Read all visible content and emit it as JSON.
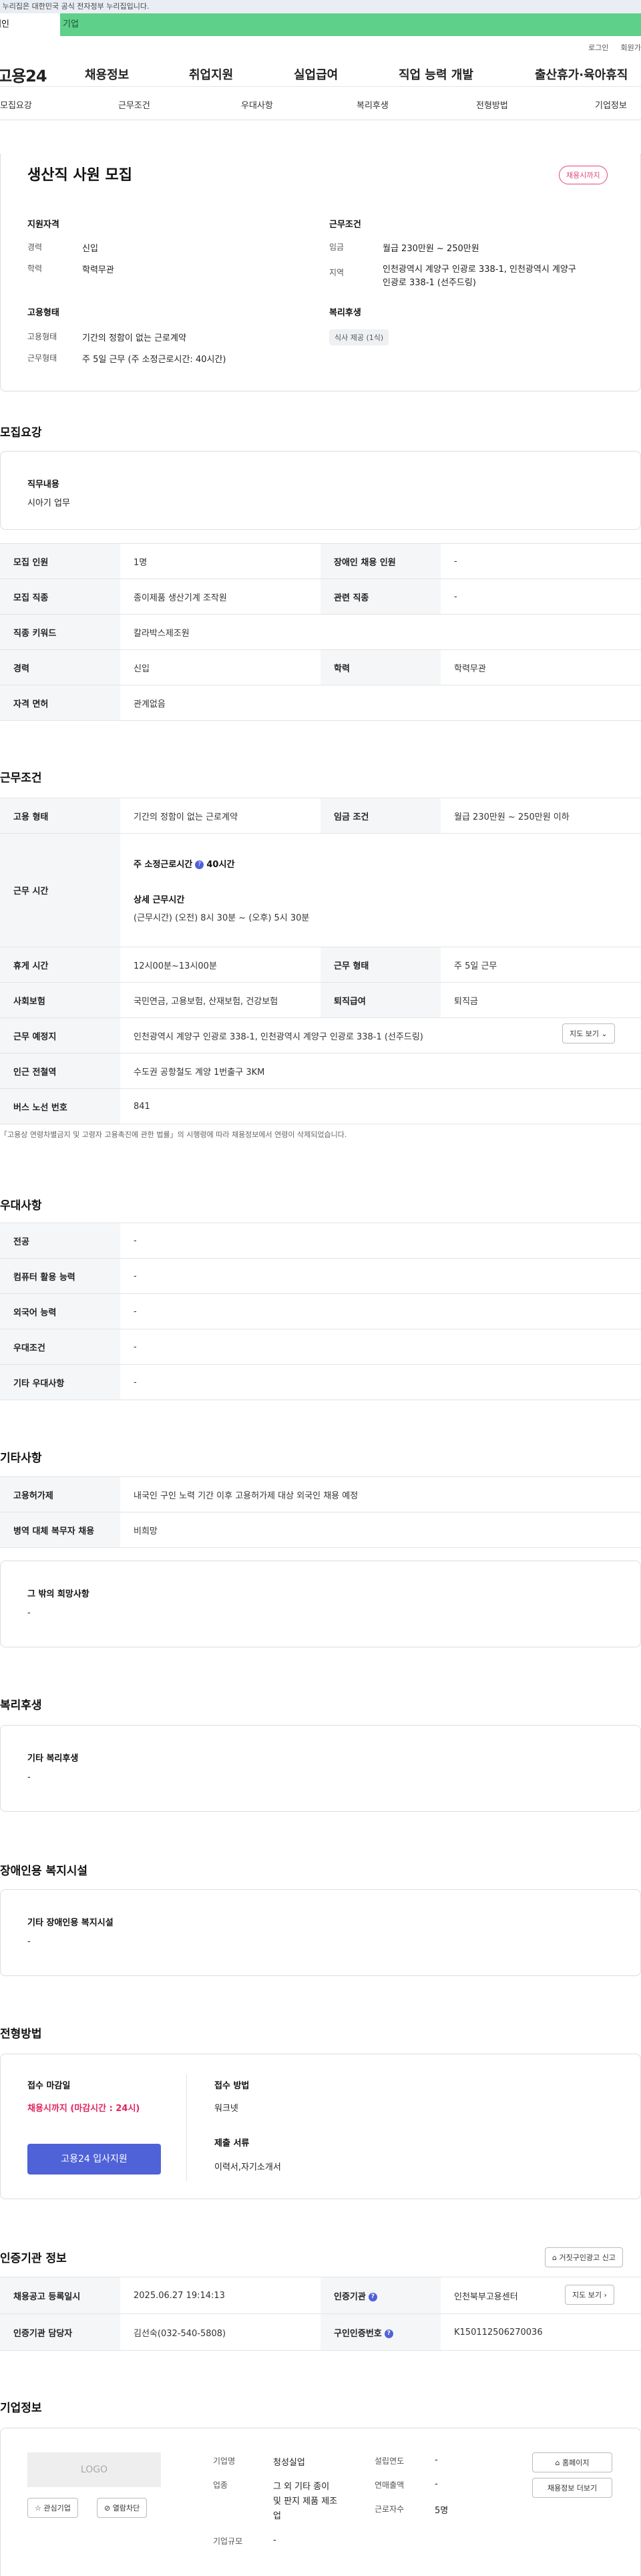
{
  "gov_banner": "이 누리집은 대한민국 공식 전자정부 누리집입니다.",
  "user_tabs": {
    "person": "개인",
    "company": "기업"
  },
  "util": {
    "login": "로그인",
    "join": "회원가입"
  },
  "logo": "고용24",
  "gnb": [
    "채용정보",
    "취업지원",
    "실업급여",
    "직업 능력 개발",
    "출산휴가·육아휴직"
  ],
  "subnav": [
    "모집요강",
    "근무조건",
    "우대사항",
    "복리후생",
    "전형방법",
    "기업정보"
  ],
  "job": {
    "title": "생산직 사원 모집",
    "status_badge": "채용시까지",
    "qualification_title": "지원자격",
    "career_label": "경력",
    "career_value": "신입",
    "education_label": "학력",
    "education_value": "학력무관",
    "employment_title": "고용형태",
    "employment_type_label": "고용형태",
    "employment_type_value": "기간의 정함이 없는 근로계약",
    "work_type_label": "근무형태",
    "work_type_value": "주 5일 근무 (주 소정근로시간: 40시간)",
    "conditions_title": "근무조건",
    "wage_label": "임금",
    "wage_value": "월급 230만원 ~ 250만원",
    "region_label": "지역",
    "region_value_1": "인천광역시 계양구 인광로 338-1, 인천광역시 계양구",
    "region_value_2": "인광로 338-1 (선주드링)",
    "welfare_title": "복리후생",
    "welfare_chip": "식사 제공 (1식)"
  },
  "recruit": {
    "title": "모집요강",
    "duty_label": "직무내용",
    "duty_value": "시아기 업무",
    "rows": [
      [
        "모집 인원",
        "1명",
        "장애인 채용 인원",
        "-"
      ],
      [
        "모집 직종",
        "종이제품 생산기계 조작원",
        "관련 직종",
        "-"
      ],
      [
        "직종 키워드",
        "칼라박스제조원"
      ],
      [
        "경력",
        "신입",
        "학력",
        "학력무관"
      ],
      [
        "자격 면허",
        "관계없음"
      ]
    ]
  },
  "work": {
    "title": "근무조건",
    "employment_label": "고용 형태",
    "employment_value": "기간의 정함이 없는 근로계약",
    "wage_label": "임금 조건",
    "wage_value": "월급 230만원 ~ 250만원 이하",
    "hours_label": "근무 시간",
    "weekly_hours_label": "주 소정근로시간",
    "weekly_hours_value": "40시간",
    "detail_hours_label": "상세 근무시간",
    "detail_hours_value": "(근무시간) (오전) 8시 30분 ~ (오후) 5시 30분",
    "rows": [
      [
        "휴게 시간",
        "12시00분~13시00분",
        "근무 형태",
        "주 5일 근무"
      ],
      [
        "사회보험",
        "국민연금, 고용보험, 산재보험, 건강보험",
        "퇴직급여",
        "퇴직금"
      ]
    ],
    "location_label": "근무 예정지",
    "location_value": "인천광역시 계양구 인광로 338-1, 인천광역시 계양구 인광로 338-1 (선주드링)",
    "map_button": "지도 보기",
    "subway_label": "인근 전철역",
    "subway_value": "수도권 공항철도 계양 1번출구 3KM",
    "bus_label": "버스 노선 번호",
    "bus_value": "841",
    "note": "「고용상 연령차별금지 및 고령자 고용촉진에 관한 법률」의 시행령에 따라 채용정보에서 연령이 삭제되었습니다."
  },
  "preference": {
    "title": "우대사항",
    "rows": [
      [
        "전공",
        "-"
      ],
      [
        "컴퓨터 활용 능력",
        "-"
      ],
      [
        "외국어 능력",
        "-"
      ],
      [
        "우대조건",
        "-"
      ],
      [
        "기타 우대사항",
        "-"
      ]
    ]
  },
  "other": {
    "title": "기타사항",
    "rows": [
      [
        "고용허가제",
        "내국인 구인 노력 기간 이후 고용허가제 대상 외국인 채용 예정"
      ],
      [
        "병역 대체 복무자 채용",
        "비희망"
      ]
    ],
    "etc_label": "그 밖의 희망사항",
    "etc_value": "-"
  },
  "welfare": {
    "title": "복리후생",
    "label": "기타 복리후생",
    "value": "-"
  },
  "disabled": {
    "title": "장애인용 복지시설",
    "label": "기타 장애인용 복지시설",
    "value": "-"
  },
  "screening": {
    "title": "전형방법",
    "deadline_label": "접수 마감일",
    "deadline_value": "채용시까지 (마감시간 : 24시)",
    "apply_button": "고용24 입사지원",
    "method_label": "접수 방법",
    "method_value": "워크넷",
    "docs_label": "제출 서류",
    "docs_value": "이력서,자기소개서"
  },
  "certification": {
    "title": "인증기관 정보",
    "report_button": "거짓구인광고 신고",
    "rows": [
      [
        "채용공고 등록일시",
        "2025.06.27 19:14:13",
        "인증기관",
        "인천북부고용센터"
      ],
      [
        "인증기관 담당자",
        "김선숙(032-540-5808)",
        "구인인증번호",
        "K150112506270036"
      ]
    ],
    "map_button": "지도 보기"
  },
  "company": {
    "title": "기업정보",
    "logo_text": "LOGO",
    "interest_button": "관심기업",
    "block_button": "열람차단",
    "name_label": "기업명",
    "name_value": "청성실업",
    "industry_label": "업종",
    "industry_value_1": "그 외 기타 종이",
    "industry_value_2": "및 판지 제품 제조",
    "industry_value_3": "업",
    "size_label": "기업규모",
    "size_value": "-",
    "founded_label": "설립연도",
    "founded_value": "-",
    "sales_label": "연매출액",
    "sales_value": "-",
    "employees_label": "근로자수",
    "employees_value": "5명",
    "homepage_button": "홈페이지",
    "jobs_button": "채용정보 더보기"
  }
}
